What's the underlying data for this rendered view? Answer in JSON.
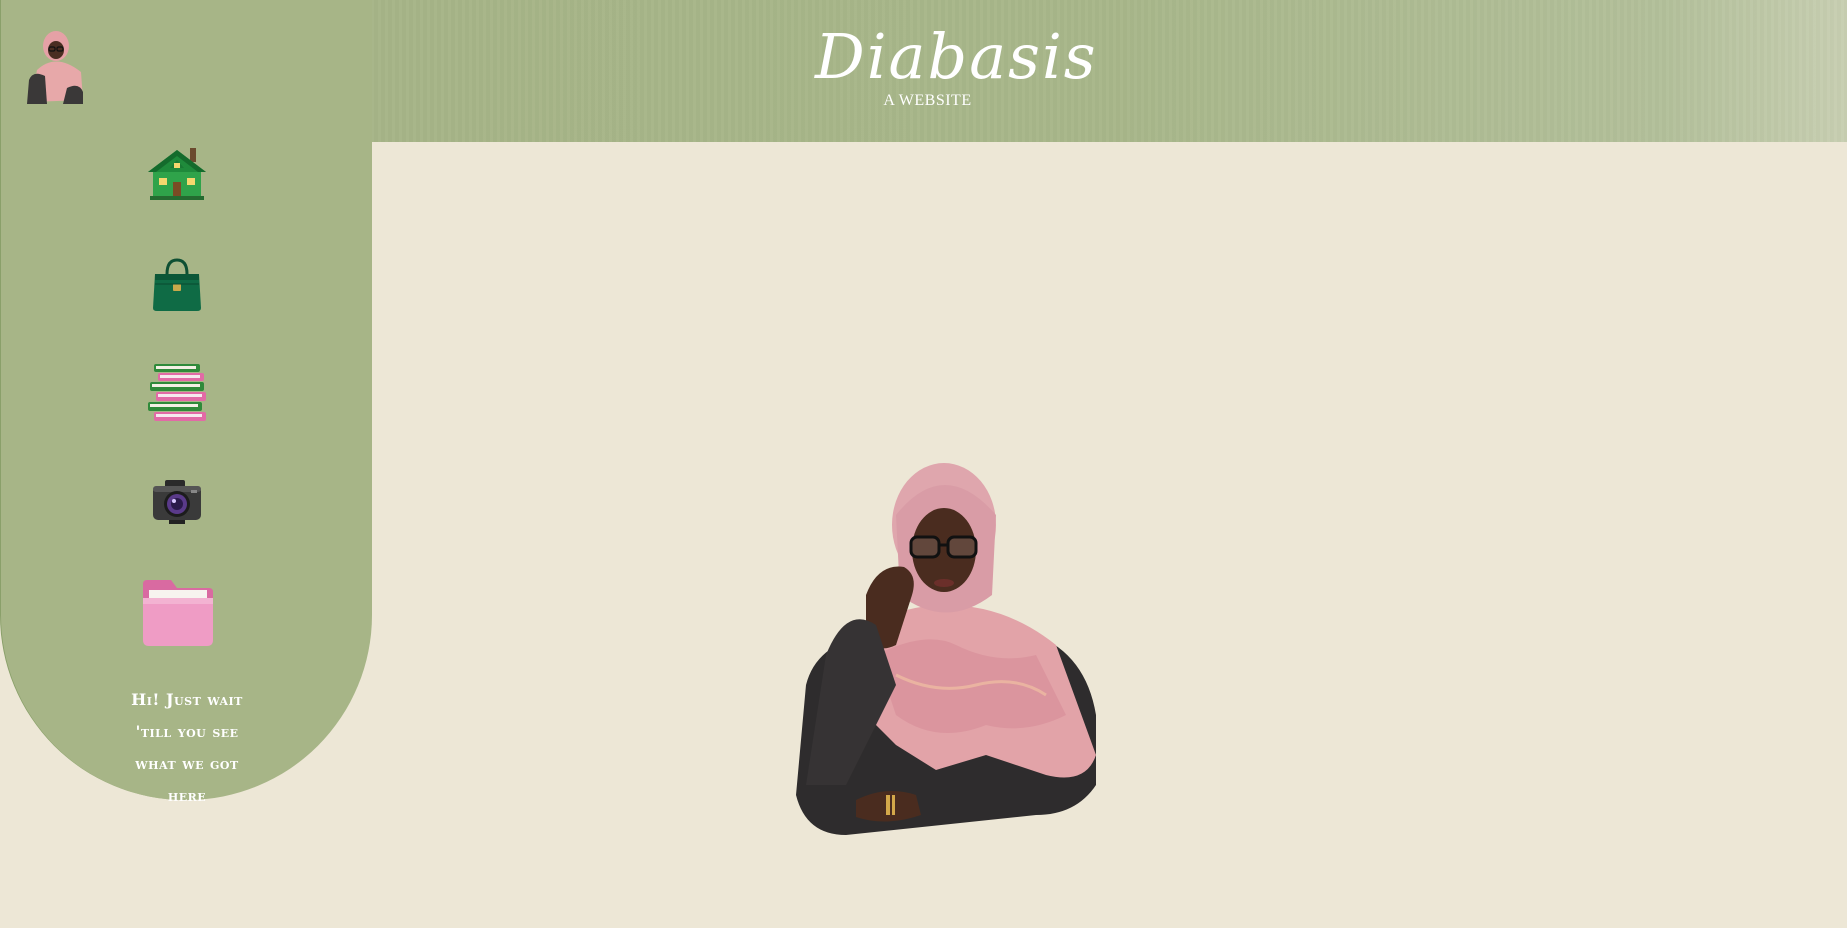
{
  "site": {
    "title": "Diabasis",
    "subtitle": "A WEBSITE"
  },
  "sidebar": {
    "avatar_icon": "profile-avatar",
    "items": [
      {
        "icon": "house-icon"
      },
      {
        "icon": "handbag-icon"
      },
      {
        "icon": "books-icon"
      },
      {
        "icon": "camera-icon"
      },
      {
        "icon": "folder-icon"
      }
    ],
    "tagline": "Hi! Just wait 'till you see what we got here"
  },
  "main": {
    "hero_image": "portrait-image"
  },
  "colors": {
    "header_green": "#a7b587",
    "sidebar_green": "#a7b587",
    "background_cream": "#ede7d6",
    "accent_pink": "#e88bb8",
    "accent_green": "#2f8a3a"
  }
}
